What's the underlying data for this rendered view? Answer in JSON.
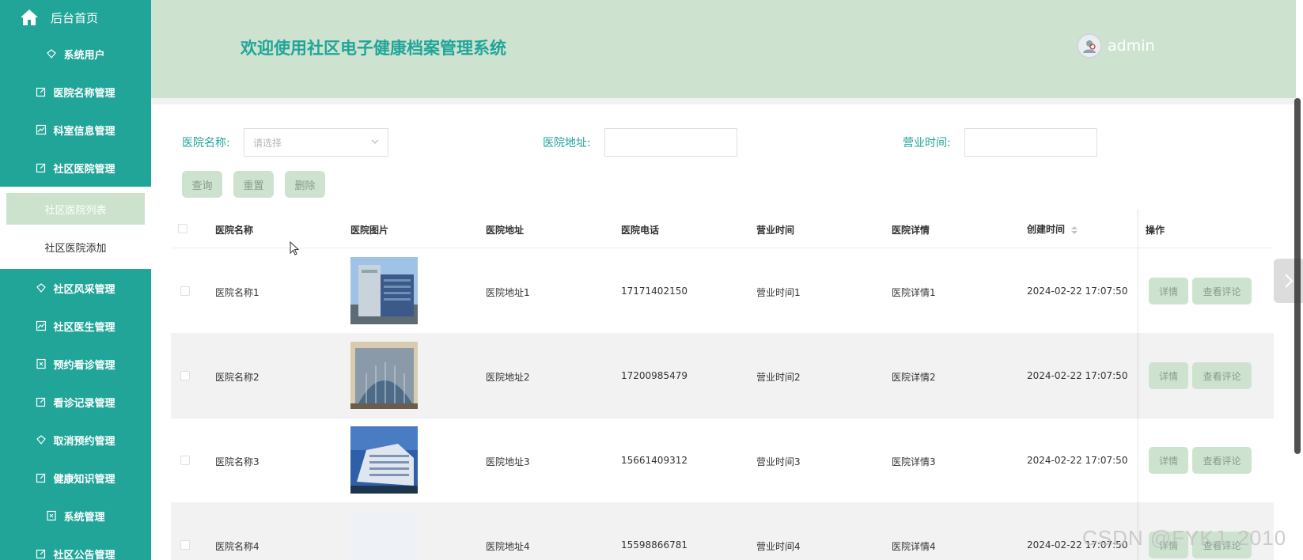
{
  "sidebar": {
    "home_label": "后台首页",
    "items_top": [
      {
        "label": "系统用户",
        "icon": "diamond-icon"
      },
      {
        "label": "医院名称管理",
        "icon": "edit-icon"
      },
      {
        "label": "科室信息管理",
        "icon": "chart-icon"
      },
      {
        "label": "社区医院管理",
        "icon": "edit-icon"
      }
    ],
    "sub_items": [
      {
        "label": "社区医院列表",
        "active": true
      },
      {
        "label": "社区医院添加",
        "active": false
      }
    ],
    "items_bottom": [
      {
        "label": "社区风采管理",
        "icon": "diamond-icon"
      },
      {
        "label": "社区医生管理",
        "icon": "chart-icon"
      },
      {
        "label": "预约看诊管理",
        "icon": "doc-icon"
      },
      {
        "label": "看诊记录管理",
        "icon": "edit-icon"
      },
      {
        "label": "取消预约管理",
        "icon": "diamond-icon"
      },
      {
        "label": "健康知识管理",
        "icon": "edit-icon"
      },
      {
        "label": "系统管理",
        "icon": "doc-icon"
      },
      {
        "label": "社区公告管理",
        "icon": "edit-icon"
      }
    ]
  },
  "header": {
    "title": "欢迎使用社区电子健康档案管理系统",
    "username": "admin"
  },
  "filters": {
    "hospital_name_label": "医院名称:",
    "hospital_name_placeholder": "请选择",
    "address_label": "医院地址:",
    "address_value": "",
    "hours_label": "营业时间:",
    "hours_value": ""
  },
  "actions": {
    "query": "查询",
    "reset": "重置",
    "delete": "删除"
  },
  "table": {
    "columns": [
      "医院名称",
      "医院图片",
      "医院地址",
      "医院电话",
      "营业时间",
      "医院详情",
      "创建时间",
      "操作"
    ],
    "rows": [
      {
        "name": "医院名称1",
        "address": "医院地址1",
        "phone": "17171402150",
        "hours": "营业时间1",
        "detail": "医院详情1",
        "created": "2024-02-22 17:07:50"
      },
      {
        "name": "医院名称2",
        "address": "医院地址2",
        "phone": "17200985479",
        "hours": "营业时间2",
        "detail": "医院详情2",
        "created": "2024-02-22 17:07:50"
      },
      {
        "name": "医院名称3",
        "address": "医院地址3",
        "phone": "15661409312",
        "hours": "营业时间3",
        "detail": "医院详情3",
        "created": "2024-02-22 17:07:50"
      },
      {
        "name": "医院名称4",
        "address": "医院地址4",
        "phone": "15598866781",
        "hours": "营业时间4",
        "detail": "医院详情4",
        "created": "2024-02-22 17:07:50"
      }
    ],
    "row_actions": {
      "detail": "详情",
      "comments": "查看评论"
    }
  },
  "watermark": "CSDN @FYKJ_2010",
  "colors": {
    "primary": "#21a599",
    "header_bg": "#cde3d0",
    "button_bg": "#cde3d0"
  }
}
